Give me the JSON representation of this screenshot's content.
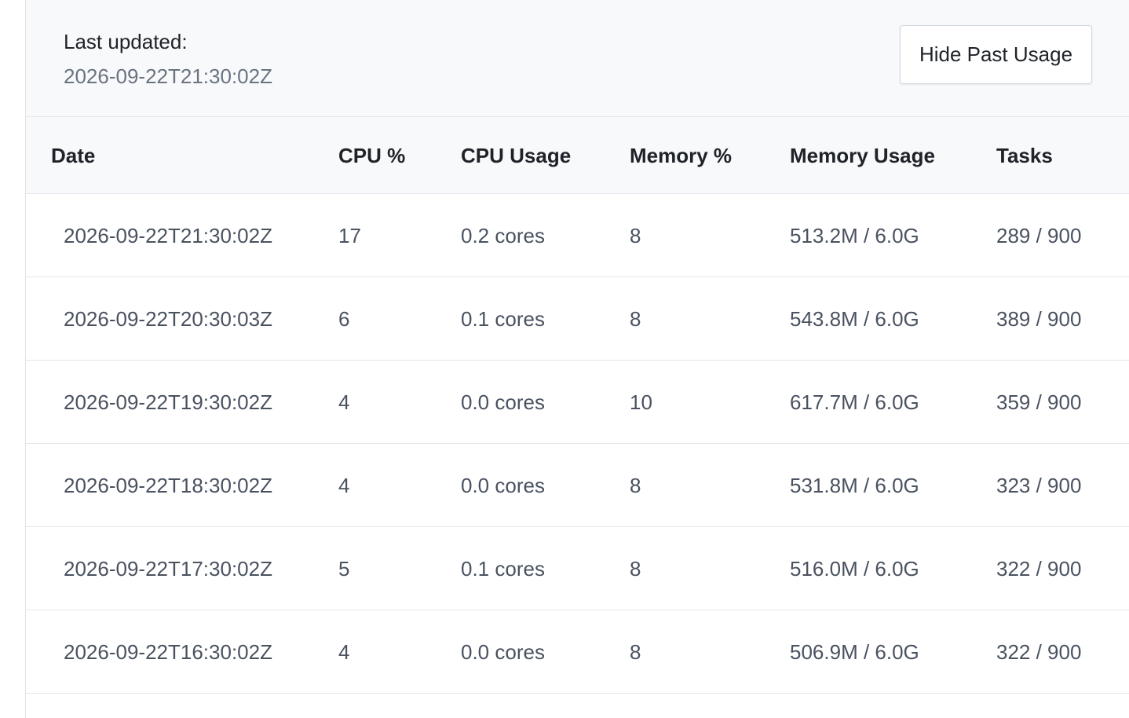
{
  "header": {
    "last_updated_label": "Last updated:",
    "last_updated_value": "2026-09-22T21:30:02Z",
    "hide_button_label": "Hide Past Usage"
  },
  "table": {
    "columns": [
      "Date",
      "CPU %",
      "CPU Usage",
      "Memory %",
      "Memory Usage",
      "Tasks"
    ],
    "rows": [
      [
        "2026-09-22T21:30:02Z",
        "17",
        "0.2 cores",
        "8",
        "513.2M / 6.0G",
        "289 / 900"
      ],
      [
        "2026-09-22T20:30:03Z",
        "6",
        "0.1 cores",
        "8",
        "543.8M / 6.0G",
        "389 / 900"
      ],
      [
        "2026-09-22T19:30:02Z",
        "4",
        "0.0 cores",
        "10",
        "617.7M / 6.0G",
        "359 / 900"
      ],
      [
        "2026-09-22T18:30:02Z",
        "4",
        "0.0 cores",
        "8",
        "531.8M / 6.0G",
        "323 / 900"
      ],
      [
        "2026-09-22T17:30:02Z",
        "5",
        "0.1 cores",
        "8",
        "516.0M / 6.0G",
        "322 / 900"
      ],
      [
        "2026-09-22T16:30:02Z",
        "4",
        "0.0 cores",
        "8",
        "506.9M / 6.0G",
        "322 / 900"
      ]
    ]
  }
}
